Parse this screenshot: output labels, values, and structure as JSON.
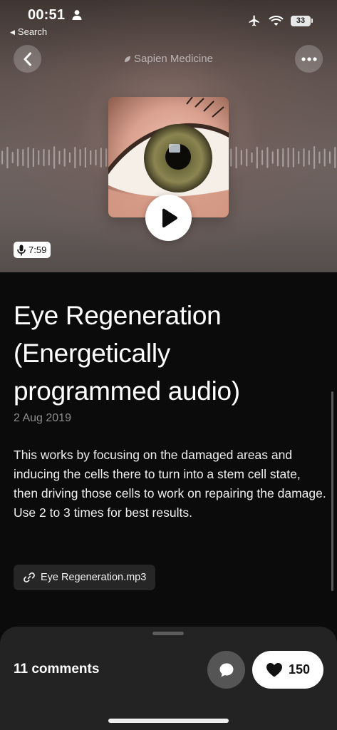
{
  "status_bar": {
    "time": "00:51",
    "back_label": "Search",
    "battery": "33",
    "icons": [
      "person-icon",
      "airplane-icon",
      "wifi-icon",
      "battery-icon"
    ]
  },
  "header": {
    "channel": "Sapien Medicine",
    "back_icon": "chevron-left-icon",
    "more_icon": "ellipsis-icon"
  },
  "player": {
    "duration": "7:59",
    "play_icon": "play-icon",
    "mic_icon": "microphone-icon"
  },
  "post": {
    "title": "Eye Regeneration (Energetically programmed audio)",
    "date": "2 Aug 2019",
    "description": "This works by focusing on the damaged areas and inducing the cells there to turn into a stem cell state, then driving those cells to work on repairing the damage. Use 2 to 3 times for best results.",
    "attachment": "Eye Regeneration.mp3"
  },
  "footer": {
    "comments": "11 comments",
    "likes": "150",
    "comment_icon": "speech-bubble-icon",
    "like_icon": "heart-icon"
  },
  "colors": {
    "background": "#0b0b0b",
    "sheet": "#232323",
    "muted_text": "#8d8d8d"
  }
}
